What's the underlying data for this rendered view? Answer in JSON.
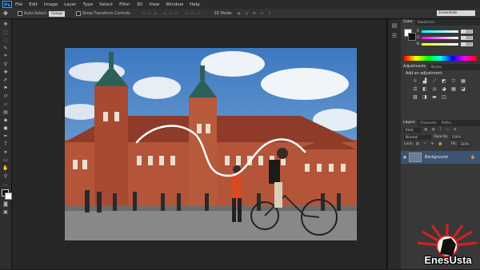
{
  "app": {
    "logo": "Ps"
  },
  "menu": [
    "File",
    "Edit",
    "Image",
    "Layer",
    "Type",
    "Select",
    "Filter",
    "3D",
    "View",
    "Window",
    "Help"
  ],
  "options": {
    "auto_select": "Auto-Select:",
    "auto_select_value": "Group",
    "show_transform": "Show Transform Controls",
    "mode_3d": "3D Mode:",
    "workspace": "Essentials"
  },
  "tools": [
    "move-icon",
    "marquee-icon",
    "lasso-icon",
    "quick-select-icon",
    "crop-icon",
    "eyedropper-icon",
    "healing-icon",
    "brush-icon",
    "stamp-icon",
    "history-brush-icon",
    "eraser-icon",
    "gradient-icon",
    "blur-icon",
    "dodge-icon",
    "pen-icon",
    "type-icon",
    "path-select-icon",
    "shape-icon",
    "hand-icon",
    "zoom-icon"
  ],
  "color_panel": {
    "tabs": [
      "Color",
      "Swatches"
    ],
    "sliders": [
      {
        "label": "R",
        "value": "255"
      },
      {
        "label": "G",
        "value": "255"
      },
      {
        "label": "B",
        "value": "255"
      }
    ]
  },
  "adjustments_panel": {
    "tabs": [
      "Adjustments",
      "Styles"
    ],
    "title": "Add an adjustment"
  },
  "layers_panel": {
    "tabs": [
      "Layers",
      "Channels",
      "Paths"
    ],
    "kind": "Kind",
    "blend": "Normal",
    "opacity_label": "Opacity:",
    "opacity": "100%",
    "lock_label": "Lock:",
    "fill_label": "Fill:",
    "fill": "100%",
    "layer_name": "Background"
  },
  "watermark": {
    "text": "EnesUsta"
  },
  "colors": {
    "accent": "#2fa3ff",
    "layer_selected": "#3c5373",
    "sky": "#4a86c8",
    "building": "#b4553a"
  }
}
